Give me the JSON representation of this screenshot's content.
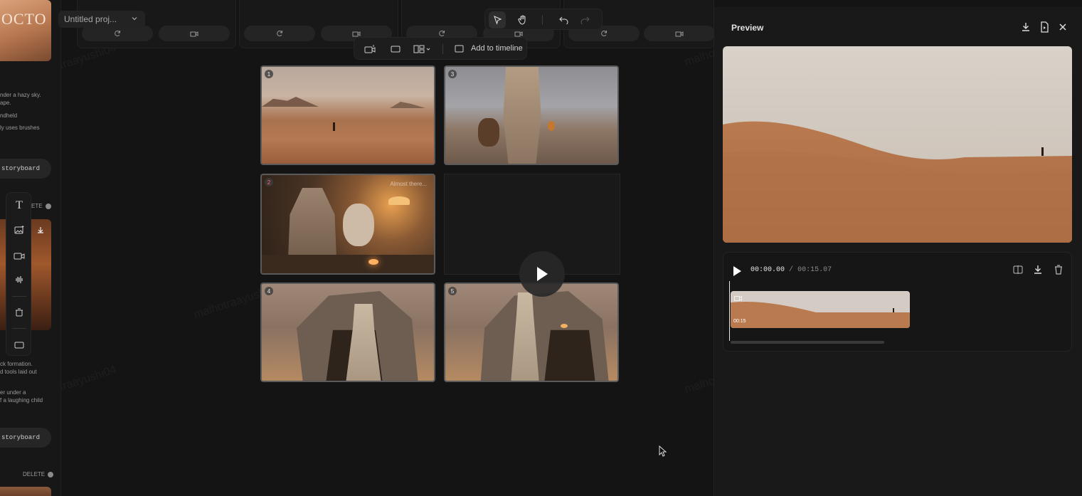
{
  "project": {
    "name": "Untitled proj..."
  },
  "left_panel": {
    "logo_text": "OCTO",
    "desc1": [
      "nder a hazy sky.",
      "ape.",
      "ndheld",
      "ly uses brushes"
    ],
    "storyboard_btn_1": "storyboard",
    "delete_1": "ETE",
    "desc2": [
      "ck formation.",
      "d tools laid out",
      "er  under a",
      "f a laughing child"
    ],
    "storyboard_btn_2": "storyboard",
    "delete_2": "DELETE"
  },
  "toolbar_secondary": {
    "add_label": "Add to timeline"
  },
  "storyboard": {
    "cells": [
      {
        "number": "1"
      },
      {
        "number": "3"
      },
      {
        "number": "2",
        "status": "Almost there..."
      },
      {
        "number": "4"
      },
      {
        "number": "5"
      }
    ]
  },
  "preview": {
    "title": "Preview",
    "current_time": "00:00.00",
    "separator": "/",
    "total_time": "00:15.07",
    "clip_duration": "00:15"
  },
  "watermark": "malhotraayushi04",
  "colors": {
    "background": "#141414",
    "panel": "#191919",
    "accent_number_red": "#ff6b6b"
  }
}
